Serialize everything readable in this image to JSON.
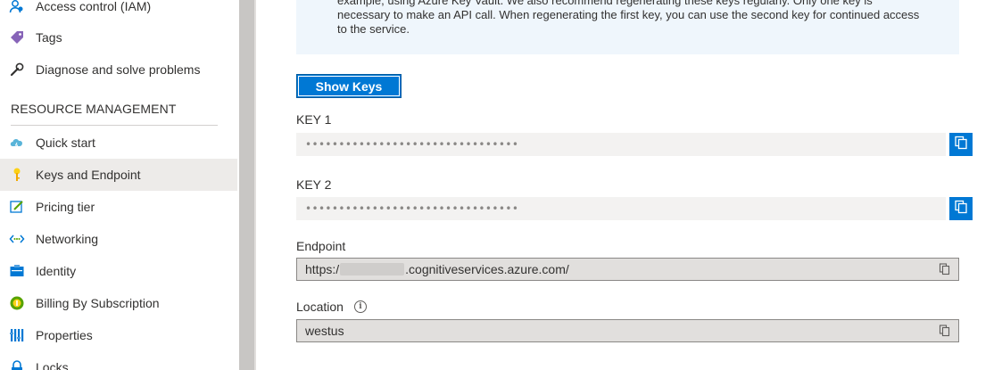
{
  "sidebar": {
    "items_top": [
      {
        "label": "Access control (IAM)",
        "icon": "people-icon"
      },
      {
        "label": "Tags",
        "icon": "tag-icon"
      },
      {
        "label": "Diagnose and solve problems",
        "icon": "wrench-icon"
      }
    ],
    "section_header": "RESOURCE MANAGEMENT",
    "items": [
      {
        "label": "Quick start",
        "icon": "cloud-lightning-icon"
      },
      {
        "label": "Keys and Endpoint",
        "icon": "key-icon",
        "selected": true
      },
      {
        "label": "Pricing tier",
        "icon": "edit-icon"
      },
      {
        "label": "Networking",
        "icon": "networking-icon"
      },
      {
        "label": "Identity",
        "icon": "identity-icon"
      },
      {
        "label": "Billing By Subscription",
        "icon": "billing-icon"
      },
      {
        "label": "Properties",
        "icon": "properties-icon"
      },
      {
        "label": "Locks",
        "icon": "lock-icon"
      }
    ]
  },
  "info": {
    "text": "example, using Azure Key Vault. We also recommend regenerating these keys regularly. Only one key is necessary to make an API call. When regenerating the first key, you can use the second key for continued access to the service."
  },
  "buttons": {
    "show_keys": "Show Keys"
  },
  "key1": {
    "label": "KEY 1",
    "value": "••••••••••••••••••••••••••••••••"
  },
  "key2": {
    "label": "KEY 2",
    "value": "••••••••••••••••••••••••••••••••"
  },
  "endpoint": {
    "label": "Endpoint",
    "prefix": "https:/",
    "suffix": ".cognitiveservices.azure.com/"
  },
  "location": {
    "label": "Location",
    "value": "westus"
  },
  "colors": {
    "accent": "#0078d4",
    "selected_bg": "#edebe9",
    "info_bg": "#eff6fc"
  }
}
